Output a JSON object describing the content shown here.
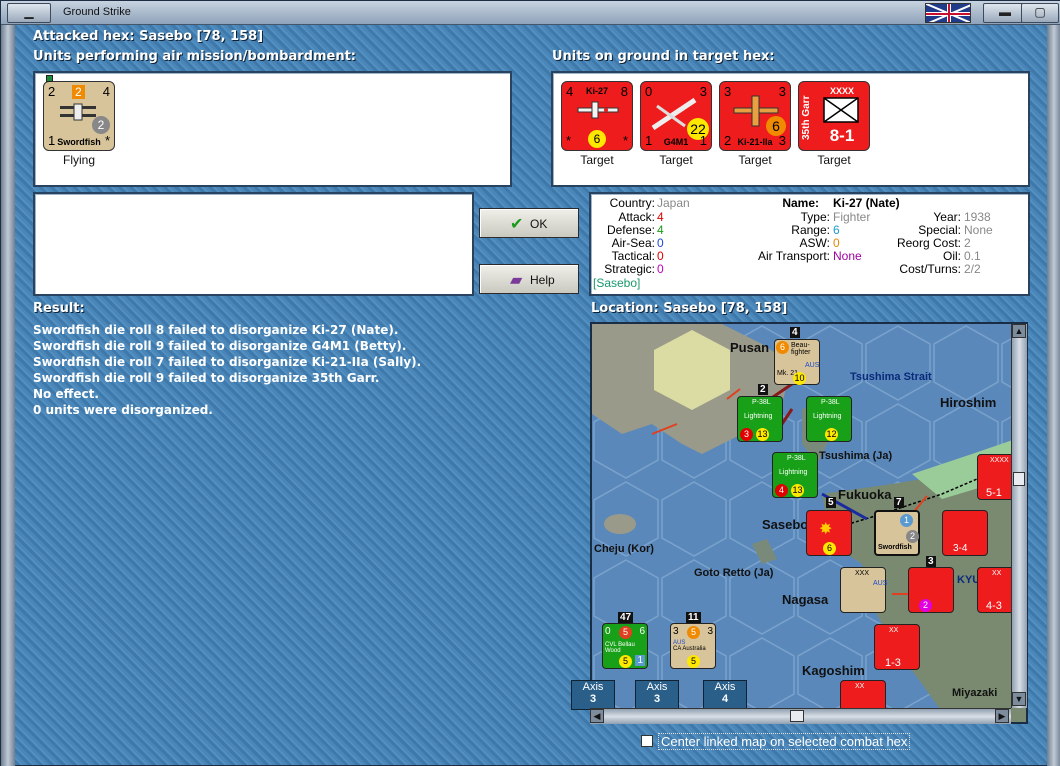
{
  "window": {
    "title": "Ground Strike"
  },
  "header": {
    "attacked_hex": "Attacked hex: Sasebo  [78, 158]"
  },
  "air_panel": {
    "heading": "Units performing air mission/bombardment:",
    "units": [
      {
        "name": "Swordfish",
        "tl": "2",
        "tm": "2",
        "tr": "4",
        "mid": "2",
        "bl": "1",
        "br": "*",
        "status": "Flying",
        "color": "#d8c49a"
      }
    ]
  },
  "ground_panel": {
    "heading": "Units on ground in target hex:",
    "units": [
      {
        "name": "Ki-27",
        "tl": "4",
        "tr": "8",
        "bl": "*",
        "br": "*",
        "circle": "6",
        "status": "Target",
        "color": "#ee1c1c"
      },
      {
        "name": "G4M1",
        "tl": "0",
        "tr": "3",
        "bl": "1",
        "br": "1",
        "circle": "22",
        "status": "Target",
        "color": "#ee1c1c"
      },
      {
        "name": "Ki-21-IIa",
        "tl": "3",
        "tr": "3",
        "bl": "2",
        "br": "3",
        "circle": "6",
        "status": "Target",
        "color": "#ee1c1c"
      },
      {
        "name": "35th Garr",
        "top": "XXXX",
        "strength": "8-1",
        "status": "Target",
        "color": "#ee1c1c"
      }
    ]
  },
  "buttons": {
    "ok": "OK",
    "help": "Help"
  },
  "unit_info": {
    "country_label": "Country:",
    "country": "Japan",
    "attack_label": "Attack:",
    "attack": "4",
    "defense_label": "Defense:",
    "defense": "4",
    "airsea_label": "Air-Sea:",
    "airsea": "0",
    "tactical_label": "Tactical:",
    "tactical": "0",
    "strategic_label": "Strategic:",
    "strategic": "0",
    "location": "[Sasebo]",
    "name_label": "Name:",
    "name": "Ki-27 (Nate)",
    "type_label": "Type:",
    "type": "Fighter",
    "range_label": "Range:",
    "range": "6",
    "asw_label": "ASW:",
    "asw": "0",
    "air_transport_label": "Air Transport:",
    "air_transport": "None",
    "year_label": "Year:",
    "year": "1938",
    "special_label": "Special:",
    "special": "None",
    "reorg_label": "Reorg Cost:",
    "reorg": "2",
    "oil_label": "Oil:",
    "oil": "0.1",
    "cost_label": "Cost/Turns:",
    "cost": "2/2"
  },
  "result": {
    "heading": "Result:",
    "lines": [
      "Swordfish die roll 8 failed to disorganize Ki-27 (Nate).",
      "Swordfish die roll 9 failed to disorganize G4M1 (Betty).",
      "Swordfish die roll 7 failed to disorganize Ki-21-IIa (Sally).",
      "Swordfish die roll 9 failed to disorganize 35th Garr.",
      "No effect.",
      "0 units were disorganized."
    ]
  },
  "map": {
    "heading": "Location:  Sasebo  [78, 158]",
    "labels": {
      "pusan": "Pusan",
      "tsushima_strait": "Tsushima Strait",
      "hiroshima": "Hiroshim",
      "tsushima": "Tsushima (Ja)",
      "fukuoka": "Fukuoka",
      "sasebo": "Sasebo",
      "cheju": "Cheju (Kor)",
      "goto": "Goto Retto (Ja)",
      "nagasaki": "Nagasa",
      "kagoshima": "Kagoshim",
      "miyazaki": "Miyazaki",
      "kyushu": "KYU"
    },
    "axis_tabs": [
      {
        "label": "Axis",
        "num": "3"
      },
      {
        "label": "Axis",
        "num": "3"
      },
      {
        "label": "Axis",
        "num": "4"
      }
    ],
    "stack_numbers": [
      "4",
      "2",
      "7",
      "5",
      "3",
      "47",
      "11"
    ],
    "counter_labels": {
      "p38": "P-38L",
      "lightning": "Lightning",
      "beau": "Beau-fighter",
      "mk21": "Mk. 21",
      "aus": "AUS",
      "swordfish": "Swordfish",
      "cvl": "CVL Bellau Wood",
      "ca": "CA Australia",
      "xx": "XX",
      "xxx": "XXX",
      "xxxx": "XXXX"
    },
    "counter_values": {
      "a": "3",
      "b": "13",
      "c": "12",
      "d": "4",
      "e": "6",
      "f": "10",
      "g": "1",
      "h": "3-4",
      "i": "2",
      "j": "5-1",
      "k": "4-3",
      "l": "1-3",
      "m": "5",
      "n": "0",
      "o": "6",
      "p": "1"
    }
  },
  "checkbox": {
    "label": "Center linked map on selected combat hex",
    "checked": false
  },
  "colors": {
    "axis_red": "#ee1c1c",
    "allied_green": "#18a018",
    "allied_tan": "#d8c49a",
    "water": "#4a86b8"
  }
}
